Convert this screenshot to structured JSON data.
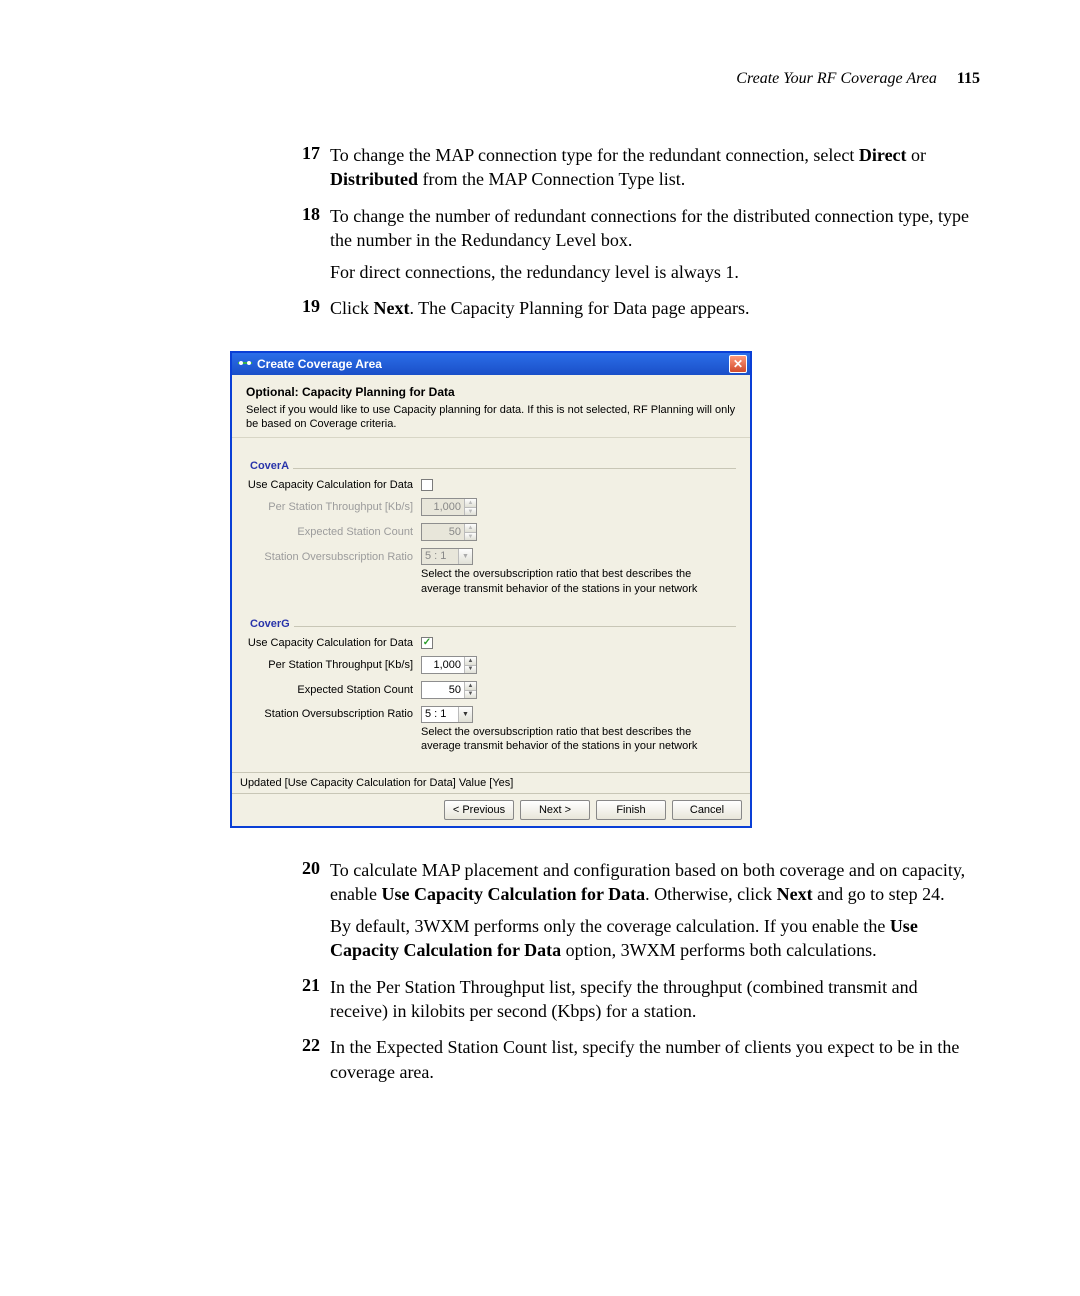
{
  "header": {
    "title": "Create Your RF Coverage Area",
    "page_number": "115"
  },
  "steps": [
    {
      "num": "17",
      "parts": [
        {
          "plain": "To change the MAP connection type for the redundant connection, select "
        },
        {
          "bold": "Direct"
        },
        {
          "plain": " or "
        },
        {
          "bold": "Distributed"
        },
        {
          "plain": " from the MAP Connection Type list."
        }
      ]
    },
    {
      "num": "18",
      "parts": [
        {
          "plain": "To change the number of redundant connections for the distributed connection type, type the number in the Redundancy Level box."
        }
      ],
      "continued": [
        {
          "plain": "For direct connections, the redundancy level is always 1."
        }
      ]
    },
    {
      "num": "19",
      "parts": [
        {
          "plain": "Click "
        },
        {
          "bold": "Next"
        },
        {
          "plain": ". The Capacity Planning for Data page appears."
        }
      ]
    }
  ],
  "dialog": {
    "window_title": "Create Coverage Area",
    "heading": "Optional: Capacity Planning for Data",
    "subheading": "Select if you would like to use Capacity planning for data. If this is not selected, RF Planning will only be based on Coverage criteria.",
    "label_use_capacity": "Use Capacity Calculation for Data",
    "label_throughput": "Per Station Throughput [Kb/s]",
    "label_station_count": "Expected Station Count",
    "label_oversub": "Station Oversubscription Ratio",
    "hint_oversub": "Select the oversubscription ratio that best describes the average transmit behavior of the stations in your network",
    "groups": [
      {
        "name": "CoverA",
        "use_capacity_checked": false,
        "throughput": "1,000",
        "station_count": "50",
        "oversub": "5 : 1",
        "disabled": true
      },
      {
        "name": "CoverG",
        "use_capacity_checked": true,
        "throughput": "1,000",
        "station_count": "50",
        "oversub": "5 : 1",
        "disabled": false
      }
    ],
    "status": "Updated [Use Capacity Calculation for Data] Value [Yes]",
    "buttons": {
      "previous": "< Previous",
      "next": "Next >",
      "finish": "Finish",
      "cancel": "Cancel"
    }
  },
  "steps_after": [
    {
      "num": "20",
      "parts": [
        {
          "plain": "To calculate MAP placement and configuration based on both coverage and on capacity, enable "
        },
        {
          "bold": "Use Capacity Calculation for Data"
        },
        {
          "plain": ". Otherwise, click "
        },
        {
          "bold": "Next"
        },
        {
          "plain": " and go to step 24."
        }
      ],
      "continued": [
        {
          "plain": "By default, 3WXM performs only the coverage calculation. If you enable the "
        },
        {
          "bold": "Use Capacity Calculation for Data"
        },
        {
          "plain": " option, 3WXM performs both calculations."
        }
      ]
    },
    {
      "num": "21",
      "parts": [
        {
          "plain": "In the Per Station Throughput list, specify the throughput (combined transmit and receive) in kilobits per second (Kbps) for a station."
        }
      ]
    },
    {
      "num": "22",
      "parts": [
        {
          "plain": "In the Expected Station Count list, specify the number of clients you expect to be in the coverage area."
        }
      ]
    }
  ]
}
